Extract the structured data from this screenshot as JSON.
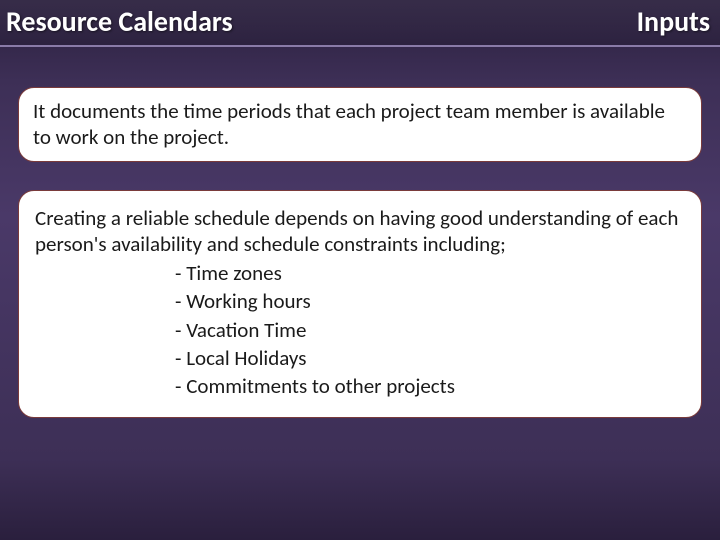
{
  "header": {
    "title_left": "Resource Calendars",
    "title_right": "Inputs"
  },
  "box1": {
    "text": "It documents the time periods that each project team member is available to work on the project."
  },
  "box2": {
    "intro": "Creating a reliable schedule depends on having good understanding of each person's availability and schedule constraints including;",
    "bullets": [
      "Time zones",
      "Working hours",
      "Vacation Time",
      "Local Holidays",
      "Commitments to other projects"
    ]
  }
}
